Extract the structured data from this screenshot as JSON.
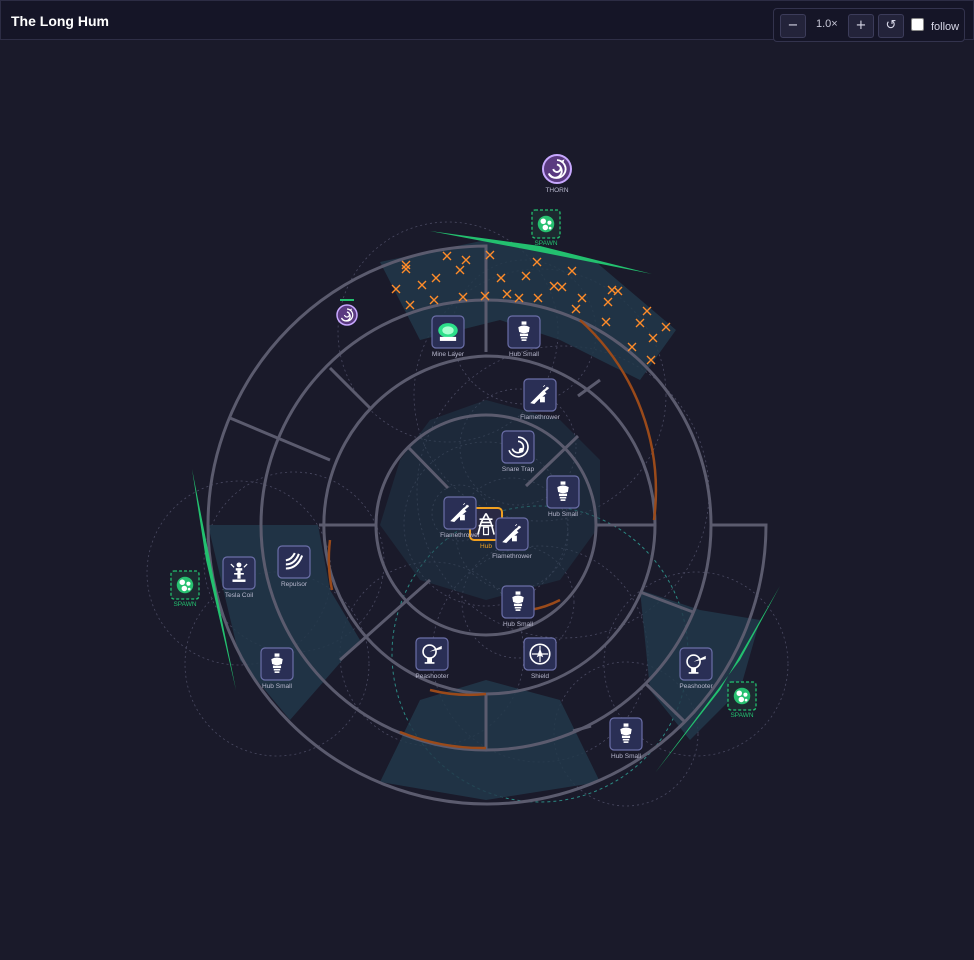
{
  "app": {
    "title": "The Long Hum"
  },
  "controls": {
    "zoom_out": "−",
    "zoom_level": "1.0×",
    "zoom_in": "+",
    "reset": "↺",
    "follow_label": "follow",
    "follow_checked": false
  },
  "colors": {
    "background": "#1a1a2a",
    "track": "#5b5b6e",
    "zone_fill": "#22384a",
    "spawn": "#23c06f",
    "hazard": "#ff8c2a",
    "buff_ring": "#9a4a1a",
    "hub": "#f0a020",
    "tile": "#2a2f55"
  },
  "enemies": {
    "thorn": {
      "label": "THORN",
      "icon": "thorn-spiral-icon"
    },
    "minion": {
      "icon": "minion-spiral-icon"
    }
  },
  "spawns": [
    {
      "label": "SPAWN",
      "icon": "spawn-orb-icon"
    },
    {
      "label": "SPAWN",
      "icon": "spawn-orb-icon"
    },
    {
      "label": "SPAWN",
      "icon": "spawn-orb-icon"
    }
  ],
  "towers": [
    {
      "id": "hub",
      "label": "Hub",
      "icon": "hub-pylon-icon"
    },
    {
      "id": "mine-layer",
      "label": "Mine Layer",
      "icon": "mine-layer-icon"
    },
    {
      "id": "hub-small-1",
      "label": "Hub Small",
      "icon": "hub-small-icon"
    },
    {
      "id": "flamethrower-1",
      "label": "Flamethrower",
      "icon": "flamethrower-icon"
    },
    {
      "id": "snare-trap",
      "label": "Snare Trap",
      "icon": "snare-trap-icon"
    },
    {
      "id": "hub-small-2",
      "label": "Hub Small",
      "icon": "hub-small-icon"
    },
    {
      "id": "flamethrower-2",
      "label": "Flamethrower",
      "icon": "flamethrower-icon"
    },
    {
      "id": "flamethrower-3",
      "label": "Flamethrower",
      "icon": "flamethrower-icon"
    },
    {
      "id": "repulsor",
      "label": "Repulsor",
      "icon": "repulsor-icon"
    },
    {
      "id": "tesla-coil",
      "label": "Tesla Coil",
      "icon": "tesla-coil-icon"
    },
    {
      "id": "hub-small-3",
      "label": "Hub Small",
      "icon": "hub-small-icon"
    },
    {
      "id": "hub-small-4",
      "label": "Hub Small",
      "icon": "hub-small-icon"
    },
    {
      "id": "peashooter-1",
      "label": "Peashooter",
      "icon": "peashooter-icon"
    },
    {
      "id": "shield",
      "label": "Shield",
      "icon": "shield-icon"
    },
    {
      "id": "peashooter-2",
      "label": "Peashooter",
      "icon": "peashooter-icon"
    },
    {
      "id": "hub-small-5",
      "label": "Hub Small",
      "icon": "hub-small-icon"
    }
  ]
}
